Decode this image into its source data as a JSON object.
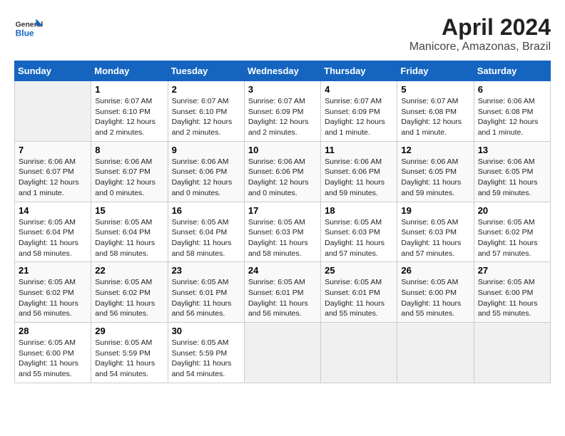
{
  "header": {
    "logo_general": "General",
    "logo_blue": "Blue",
    "month_year": "April 2024",
    "location": "Manicore, Amazonas, Brazil"
  },
  "days_of_week": [
    "Sunday",
    "Monday",
    "Tuesday",
    "Wednesday",
    "Thursday",
    "Friday",
    "Saturday"
  ],
  "weeks": [
    [
      {
        "day": "",
        "sunrise": "",
        "sunset": "",
        "daylight": ""
      },
      {
        "day": "1",
        "sunrise": "Sunrise: 6:07 AM",
        "sunset": "Sunset: 6:10 PM",
        "daylight": "Daylight: 12 hours and 2 minutes."
      },
      {
        "day": "2",
        "sunrise": "Sunrise: 6:07 AM",
        "sunset": "Sunset: 6:10 PM",
        "daylight": "Daylight: 12 hours and 2 minutes."
      },
      {
        "day": "3",
        "sunrise": "Sunrise: 6:07 AM",
        "sunset": "Sunset: 6:09 PM",
        "daylight": "Daylight: 12 hours and 2 minutes."
      },
      {
        "day": "4",
        "sunrise": "Sunrise: 6:07 AM",
        "sunset": "Sunset: 6:09 PM",
        "daylight": "Daylight: 12 hours and 1 minute."
      },
      {
        "day": "5",
        "sunrise": "Sunrise: 6:07 AM",
        "sunset": "Sunset: 6:08 PM",
        "daylight": "Daylight: 12 hours and 1 minute."
      },
      {
        "day": "6",
        "sunrise": "Sunrise: 6:06 AM",
        "sunset": "Sunset: 6:08 PM",
        "daylight": "Daylight: 12 hours and 1 minute."
      }
    ],
    [
      {
        "day": "7",
        "sunrise": "Sunrise: 6:06 AM",
        "sunset": "Sunset: 6:07 PM",
        "daylight": "Daylight: 12 hours and 1 minute."
      },
      {
        "day": "8",
        "sunrise": "Sunrise: 6:06 AM",
        "sunset": "Sunset: 6:07 PM",
        "daylight": "Daylight: 12 hours and 0 minutes."
      },
      {
        "day": "9",
        "sunrise": "Sunrise: 6:06 AM",
        "sunset": "Sunset: 6:06 PM",
        "daylight": "Daylight: 12 hours and 0 minutes."
      },
      {
        "day": "10",
        "sunrise": "Sunrise: 6:06 AM",
        "sunset": "Sunset: 6:06 PM",
        "daylight": "Daylight: 12 hours and 0 minutes."
      },
      {
        "day": "11",
        "sunrise": "Sunrise: 6:06 AM",
        "sunset": "Sunset: 6:06 PM",
        "daylight": "Daylight: 11 hours and 59 minutes."
      },
      {
        "day": "12",
        "sunrise": "Sunrise: 6:06 AM",
        "sunset": "Sunset: 6:05 PM",
        "daylight": "Daylight: 11 hours and 59 minutes."
      },
      {
        "day": "13",
        "sunrise": "Sunrise: 6:06 AM",
        "sunset": "Sunset: 6:05 PM",
        "daylight": "Daylight: 11 hours and 59 minutes."
      }
    ],
    [
      {
        "day": "14",
        "sunrise": "Sunrise: 6:05 AM",
        "sunset": "Sunset: 6:04 PM",
        "daylight": "Daylight: 11 hours and 58 minutes."
      },
      {
        "day": "15",
        "sunrise": "Sunrise: 6:05 AM",
        "sunset": "Sunset: 6:04 PM",
        "daylight": "Daylight: 11 hours and 58 minutes."
      },
      {
        "day": "16",
        "sunrise": "Sunrise: 6:05 AM",
        "sunset": "Sunset: 6:04 PM",
        "daylight": "Daylight: 11 hours and 58 minutes."
      },
      {
        "day": "17",
        "sunrise": "Sunrise: 6:05 AM",
        "sunset": "Sunset: 6:03 PM",
        "daylight": "Daylight: 11 hours and 58 minutes."
      },
      {
        "day": "18",
        "sunrise": "Sunrise: 6:05 AM",
        "sunset": "Sunset: 6:03 PM",
        "daylight": "Daylight: 11 hours and 57 minutes."
      },
      {
        "day": "19",
        "sunrise": "Sunrise: 6:05 AM",
        "sunset": "Sunset: 6:03 PM",
        "daylight": "Daylight: 11 hours and 57 minutes."
      },
      {
        "day": "20",
        "sunrise": "Sunrise: 6:05 AM",
        "sunset": "Sunset: 6:02 PM",
        "daylight": "Daylight: 11 hours and 57 minutes."
      }
    ],
    [
      {
        "day": "21",
        "sunrise": "Sunrise: 6:05 AM",
        "sunset": "Sunset: 6:02 PM",
        "daylight": "Daylight: 11 hours and 56 minutes."
      },
      {
        "day": "22",
        "sunrise": "Sunrise: 6:05 AM",
        "sunset": "Sunset: 6:02 PM",
        "daylight": "Daylight: 11 hours and 56 minutes."
      },
      {
        "day": "23",
        "sunrise": "Sunrise: 6:05 AM",
        "sunset": "Sunset: 6:01 PM",
        "daylight": "Daylight: 11 hours and 56 minutes."
      },
      {
        "day": "24",
        "sunrise": "Sunrise: 6:05 AM",
        "sunset": "Sunset: 6:01 PM",
        "daylight": "Daylight: 11 hours and 56 minutes."
      },
      {
        "day": "25",
        "sunrise": "Sunrise: 6:05 AM",
        "sunset": "Sunset: 6:01 PM",
        "daylight": "Daylight: 11 hours and 55 minutes."
      },
      {
        "day": "26",
        "sunrise": "Sunrise: 6:05 AM",
        "sunset": "Sunset: 6:00 PM",
        "daylight": "Daylight: 11 hours and 55 minutes."
      },
      {
        "day": "27",
        "sunrise": "Sunrise: 6:05 AM",
        "sunset": "Sunset: 6:00 PM",
        "daylight": "Daylight: 11 hours and 55 minutes."
      }
    ],
    [
      {
        "day": "28",
        "sunrise": "Sunrise: 6:05 AM",
        "sunset": "Sunset: 6:00 PM",
        "daylight": "Daylight: 11 hours and 55 minutes."
      },
      {
        "day": "29",
        "sunrise": "Sunrise: 6:05 AM",
        "sunset": "Sunset: 5:59 PM",
        "daylight": "Daylight: 11 hours and 54 minutes."
      },
      {
        "day": "30",
        "sunrise": "Sunrise: 6:05 AM",
        "sunset": "Sunset: 5:59 PM",
        "daylight": "Daylight: 11 hours and 54 minutes."
      },
      {
        "day": "",
        "sunrise": "",
        "sunset": "",
        "daylight": ""
      },
      {
        "day": "",
        "sunrise": "",
        "sunset": "",
        "daylight": ""
      },
      {
        "day": "",
        "sunrise": "",
        "sunset": "",
        "daylight": ""
      },
      {
        "day": "",
        "sunrise": "",
        "sunset": "",
        "daylight": ""
      }
    ]
  ]
}
